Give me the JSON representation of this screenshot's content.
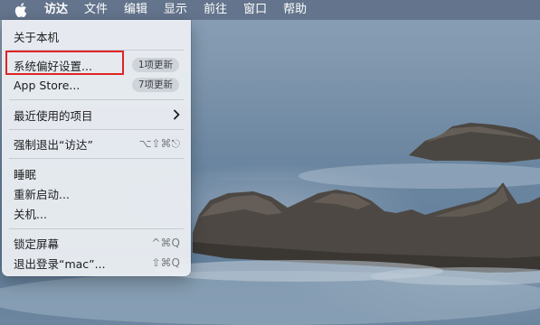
{
  "menubar": {
    "apple_icon": "apple-logo-icon",
    "items": [
      "访达",
      "文件",
      "编辑",
      "显示",
      "前往",
      "窗口",
      "帮助"
    ]
  },
  "apple_menu": {
    "about": "关于本机",
    "system_prefs": {
      "label": "系统偏好设置...",
      "badge": "1项更新"
    },
    "app_store": {
      "label": "App Store...",
      "badge": "7项更新"
    },
    "recent_items": {
      "label": "最近使用的项目",
      "submenu_icon": "chevron-right-icon"
    },
    "force_quit": {
      "label": "强制退出“访达”",
      "shortcut": "⌥⇧⌘⎋"
    },
    "sleep": "睡眠",
    "restart": "重新启动...",
    "shutdown": "关机...",
    "lock_screen": {
      "label": "锁定屏幕",
      "shortcut": "^⌘Q"
    },
    "logout": {
      "label": "退出登录“mac”...",
      "shortcut": "⇧⌘Q"
    }
  },
  "colors": {
    "highlight_border": "#e02424",
    "menubar_bg": "#586880",
    "menu_bg": "#eceff3"
  }
}
